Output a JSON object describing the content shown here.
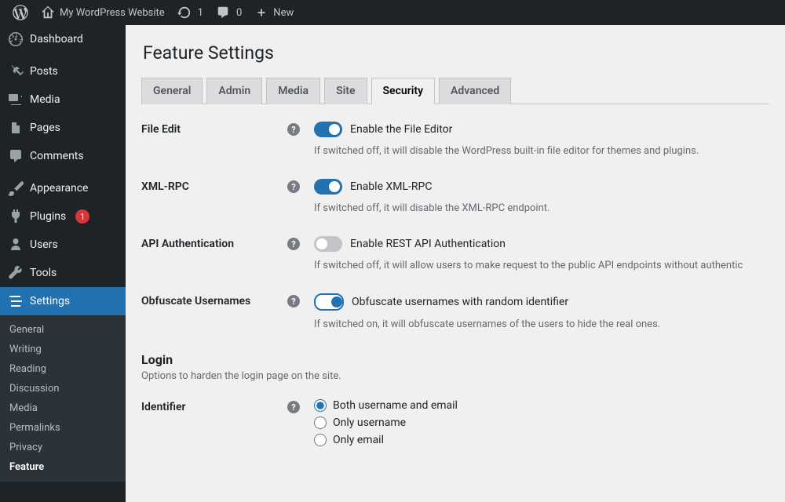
{
  "adminbar": {
    "site_name": "My WordPress Website",
    "updates_count": "1",
    "comments_count": "0",
    "new_label": "New"
  },
  "sidebar": {
    "items": [
      {
        "label": "Dashboard",
        "icon": "dashboard"
      },
      {
        "label": "Posts",
        "icon": "pin"
      },
      {
        "label": "Media",
        "icon": "media"
      },
      {
        "label": "Pages",
        "icon": "pages"
      },
      {
        "label": "Comments",
        "icon": "comment"
      },
      {
        "label": "Appearance",
        "icon": "brush"
      },
      {
        "label": "Plugins",
        "icon": "plug",
        "badge": "1"
      },
      {
        "label": "Users",
        "icon": "user"
      },
      {
        "label": "Tools",
        "icon": "wrench"
      },
      {
        "label": "Settings",
        "icon": "sliders"
      }
    ],
    "submenu": [
      "General",
      "Writing",
      "Reading",
      "Discussion",
      "Media",
      "Permalinks",
      "Privacy",
      "Feature"
    ],
    "submenu_current": "Feature"
  },
  "page": {
    "title": "Feature Settings",
    "tabs": [
      "General",
      "Admin",
      "Media",
      "Site",
      "Security",
      "Advanced"
    ],
    "active_tab": "Security"
  },
  "settings": {
    "file_edit": {
      "heading": "File Edit",
      "label": "Enable the File Editor",
      "on": true,
      "desc": "If switched off, it will disable the WordPress built-in file editor for themes and plugins."
    },
    "xmlrpc": {
      "heading": "XML-RPC",
      "label": "Enable XML-RPC",
      "on": true,
      "desc": "If switched off, it will disable the XML-RPC endpoint."
    },
    "api_auth": {
      "heading": "API Authentication",
      "label": "Enable REST API Authentication",
      "on": false,
      "desc": "If switched off, it will allow users to make request to the public API endpoints without authentic"
    },
    "obfuscate": {
      "heading": "Obfuscate Usernames",
      "label": "Obfuscate usernames with random identifier",
      "on": true,
      "outline": true,
      "desc": "If switched on, it will obfuscate usernames of the users to hide the real ones."
    },
    "login": {
      "heading": "Login",
      "desc": "Options to harden the login page on the site."
    },
    "identifier": {
      "heading": "Identifier",
      "options": [
        "Both username and email",
        "Only username",
        "Only email"
      ],
      "selected": 0
    }
  }
}
